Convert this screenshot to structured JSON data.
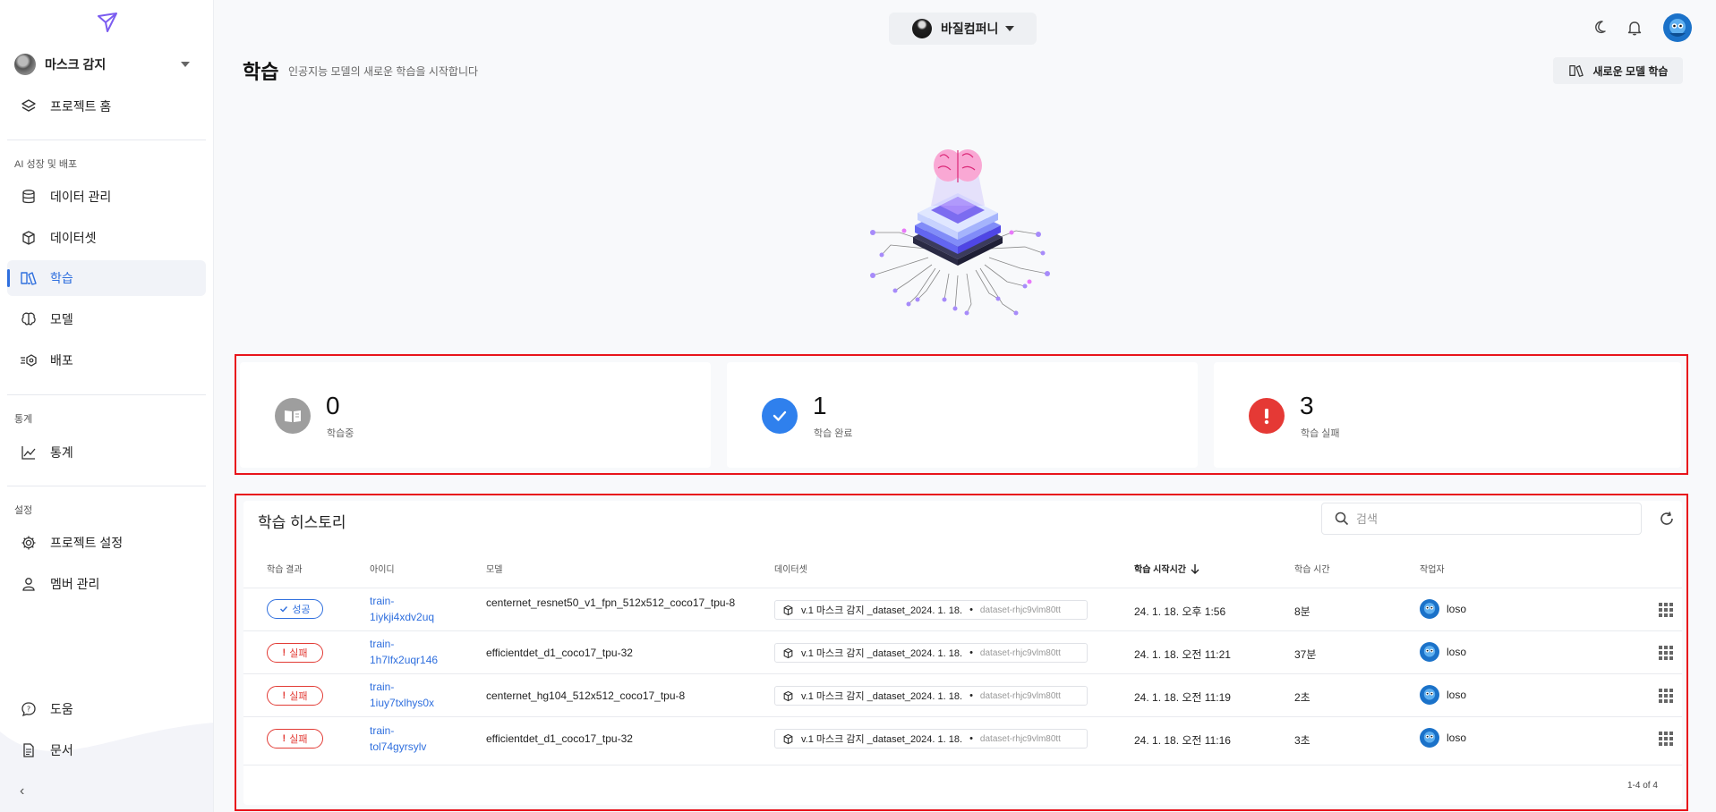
{
  "sidebar": {
    "project_name": "마스크 감지",
    "items": [
      {
        "label": "프로젝트 홈",
        "icon": "layers-icon"
      },
      {
        "label": "데이터 관리",
        "icon": "database-icon"
      },
      {
        "label": "데이터셋",
        "icon": "cube-icon"
      },
      {
        "label": "학습",
        "icon": "book-icon"
      },
      {
        "label": "모델",
        "icon": "brain-icon"
      },
      {
        "label": "배포",
        "icon": "deploy-icon"
      },
      {
        "label": "통계",
        "icon": "chart-line-icon"
      },
      {
        "label": "프로젝트 설정",
        "icon": "gear-icon"
      },
      {
        "label": "멤버 관리",
        "icon": "user-icon"
      },
      {
        "label": "도움",
        "icon": "help-icon"
      },
      {
        "label": "문서",
        "icon": "document-icon"
      }
    ],
    "sections": {
      "ai": "AI 성장 및 배포",
      "stats": "통계",
      "settings": "설정"
    }
  },
  "topbar": {
    "company": "바질컴퍼니"
  },
  "header": {
    "title": "학습",
    "subtitle": "인공지능 모델의 새로운 학습을 시작합니다",
    "new_button": "새로운 모델 학습"
  },
  "stats": [
    {
      "value": "0",
      "label": "학습중",
      "color": "#9e9e9e"
    },
    {
      "value": "1",
      "label": "학습 완료",
      "color": "#2f80ed"
    },
    {
      "value": "3",
      "label": "학습 실패",
      "color": "#e53935"
    }
  ],
  "history": {
    "title": "학습 히스토리",
    "search_placeholder": "검색",
    "columns": [
      "학습 결과",
      "아이디",
      "모델",
      "데이터셋",
      "학습 시작시간",
      "학습 시간",
      "작업자"
    ],
    "rows": [
      {
        "status": "성공",
        "id": "train-1iykji4xdv2uq",
        "model": "centernet_resnet50_v1_fpn_512x512_coco17_tpu-8",
        "dataset": "v.1 마스크 감지 _dataset_2024. 1. 18.",
        "dataset_id": "dataset-rhjc9vlm80tt",
        "start": "24. 1. 18. 오후 1:56",
        "duration": "8분",
        "worker": "loso"
      },
      {
        "status": "실패",
        "id": "train-1h7lfx2uqr146",
        "model": "efficientdet_d1_coco17_tpu-32",
        "dataset": "v.1 마스크 감지 _dataset_2024. 1. 18.",
        "dataset_id": "dataset-rhjc9vlm80tt",
        "start": "24. 1. 18. 오전 11:21",
        "duration": "37분",
        "worker": "loso"
      },
      {
        "status": "실패",
        "id": "train-1iuy7txlhys0x",
        "model": "centernet_hg104_512x512_coco17_tpu-8",
        "dataset": "v.1 마스크 감지 _dataset_2024. 1. 18.",
        "dataset_id": "dataset-rhjc9vlm80tt",
        "start": "24. 1. 18. 오전 11:19",
        "duration": "2초",
        "worker": "loso"
      },
      {
        "status": "실패",
        "id": "train-tol74gyrsylv",
        "model": "efficientdet_d1_coco17_tpu-32",
        "dataset": "v.1 마스크 감지 _dataset_2024. 1. 18.",
        "dataset_id": "dataset-rhjc9vlm80tt",
        "start": "24. 1. 18. 오전 11:16",
        "duration": "3초",
        "worker": "loso"
      }
    ],
    "pagination": "1-4 of 4"
  }
}
